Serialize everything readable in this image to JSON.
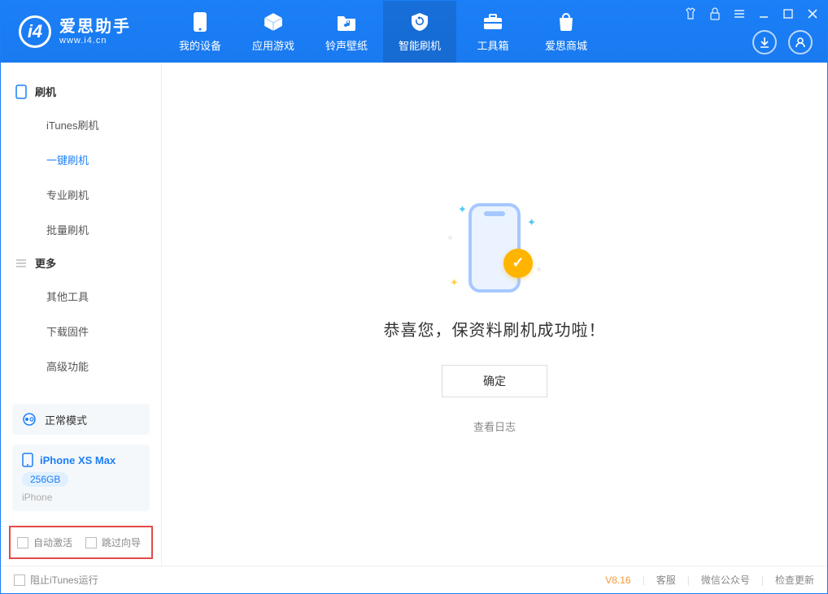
{
  "app": {
    "title": "爱思助手",
    "subtitle": "www.i4.cn"
  },
  "nav": {
    "items": [
      {
        "label": "我的设备"
      },
      {
        "label": "应用游戏"
      },
      {
        "label": "铃声壁纸"
      },
      {
        "label": "智能刷机"
      },
      {
        "label": "工具箱"
      },
      {
        "label": "爱思商城"
      }
    ]
  },
  "sidebar": {
    "section_flash": "刷机",
    "items_flash": [
      {
        "label": "iTunes刷机"
      },
      {
        "label": "一键刷机"
      },
      {
        "label": "专业刷机"
      },
      {
        "label": "批量刷机"
      }
    ],
    "section_more": "更多",
    "items_more": [
      {
        "label": "其他工具"
      },
      {
        "label": "下载固件"
      },
      {
        "label": "高级功能"
      }
    ],
    "mode": "正常模式",
    "device": {
      "name": "iPhone XS Max",
      "capacity": "256GB",
      "type": "iPhone"
    },
    "checkboxes": {
      "auto_activate": "自动激活",
      "skip_guide": "跳过向导"
    }
  },
  "main": {
    "success_text": "恭喜您，保资料刷机成功啦！",
    "ok_button": "确定",
    "log_link": "查看日志"
  },
  "footer": {
    "block_itunes": "阻止iTunes运行",
    "version": "V8.16",
    "support": "客服",
    "wechat": "微信公众号",
    "update": "检查更新"
  }
}
